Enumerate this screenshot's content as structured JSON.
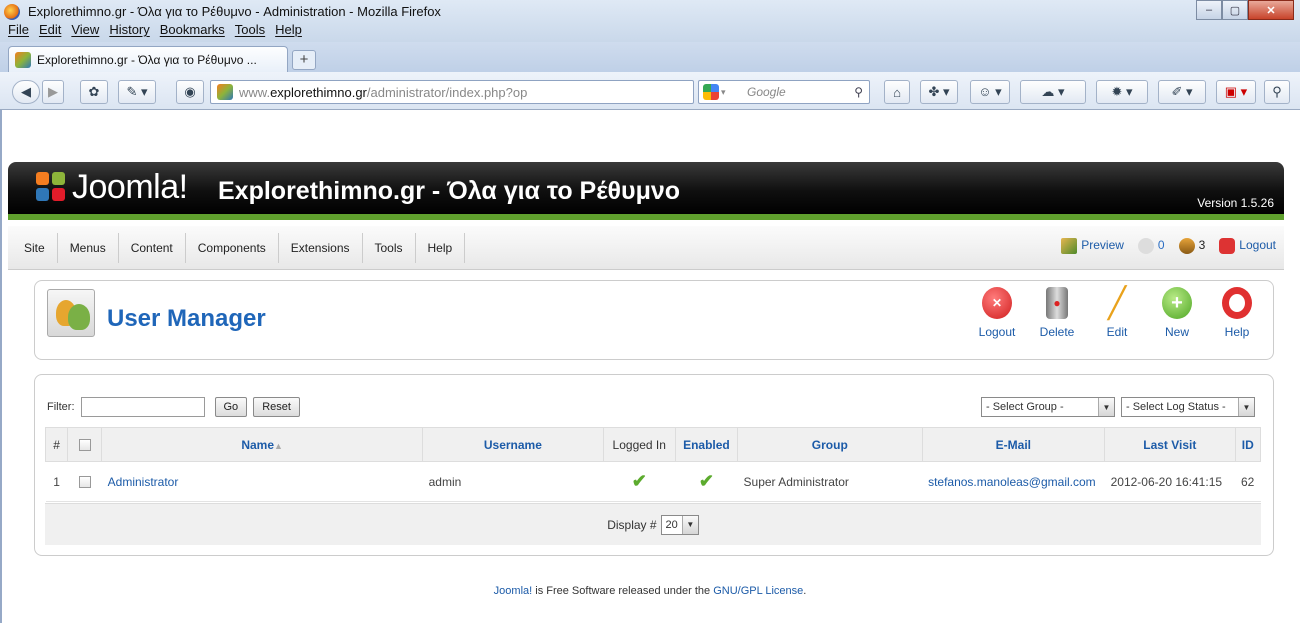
{
  "browser": {
    "window_title": "Explorethimno.gr - Όλα για το Ρέθυμνο - Administration - Mozilla Firefox",
    "menu": [
      "File",
      "Edit",
      "View",
      "History",
      "Bookmarks",
      "Tools",
      "Help"
    ],
    "tab_title": "Explorethimno.gr - Όλα για το Ρέθυμνο ...",
    "new_tab": "+",
    "url_prefix": "www.",
    "url_domain": "explorethimno.gr",
    "url_path": "/administrator/index.php?op",
    "search_placeholder": "Google"
  },
  "joomla": {
    "brand": "Joomla!",
    "site_title": "Explorethimno.gr - Όλα για το Ρέθυμνο",
    "version": "Version 1.5.26",
    "menu": [
      "Site",
      "Menus",
      "Content",
      "Components",
      "Extensions",
      "Tools",
      "Help"
    ],
    "status": {
      "preview": "Preview",
      "messages": "0",
      "users": "3",
      "logout": "Logout"
    }
  },
  "page": {
    "title": "User Manager",
    "toolbar": {
      "logout": "Logout",
      "delete": "Delete",
      "edit": "Edit",
      "new": "New",
      "help": "Help"
    }
  },
  "filters": {
    "label": "Filter:",
    "value": "",
    "go": "Go",
    "reset": "Reset",
    "group_select": "- Select Group -",
    "log_status_select": "- Select Log Status -"
  },
  "table": {
    "headers": {
      "num": "#",
      "name": "Name",
      "username": "Username",
      "logged_in": "Logged In",
      "enabled": "Enabled",
      "group": "Group",
      "email": "E-Mail",
      "last_visit": "Last Visit",
      "id": "ID"
    },
    "sort_arrow": "▲",
    "rows": [
      {
        "num": "1",
        "name": "Administrator",
        "username": "admin",
        "logged_in": "✔",
        "enabled": "✔",
        "group": "Super Administrator",
        "email": "stefanos.manoleas@gmail.com",
        "last_visit": "2012-06-20 16:41:15",
        "id": "62"
      }
    ],
    "display_label": "Display #",
    "display_value": "20"
  },
  "footer": {
    "joomla_link": "Joomla!",
    "text": " is Free Software released under the ",
    "license_link": "GNU/GPL License",
    "end": "."
  },
  "colors": {
    "link": "#1c5ba8",
    "header_green": "#5fa02d",
    "tick_green": "#5cab2e"
  }
}
